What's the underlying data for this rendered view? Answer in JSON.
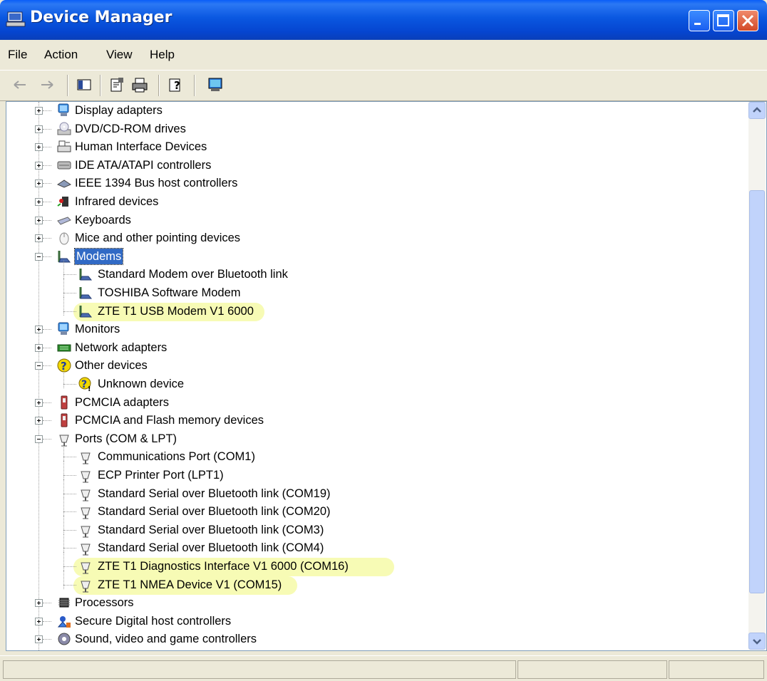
{
  "window": {
    "title": "Device Manager"
  },
  "menu": [
    "File",
    "Action",
    "View",
    "Help"
  ],
  "toolbar": {
    "icons": [
      "back-arrow-icon",
      "forward-arrow-icon",
      "show-hide-console-tree-icon",
      "properties-icon",
      "print-icon",
      "help-icon",
      "scan-hardware-icon"
    ]
  },
  "tree": [
    {
      "label": "Display adapters",
      "level": 0,
      "expander": "plus",
      "icon": "monitor-icon"
    },
    {
      "label": "DVD/CD-ROM drives",
      "level": 0,
      "expander": "plus",
      "icon": "cd-drive-icon"
    },
    {
      "label": "Human Interface Devices",
      "level": 0,
      "expander": "plus",
      "icon": "hid-icon"
    },
    {
      "label": "IDE ATA/ATAPI controllers",
      "level": 0,
      "expander": "plus",
      "icon": "ide-controller-icon"
    },
    {
      "label": "IEEE 1394 Bus host controllers",
      "level": 0,
      "expander": "plus",
      "icon": "firewire-icon"
    },
    {
      "label": "Infrared devices",
      "level": 0,
      "expander": "plus",
      "icon": "infrared-icon"
    },
    {
      "label": "Keyboards",
      "level": 0,
      "expander": "plus",
      "icon": "keyboard-icon"
    },
    {
      "label": "Mice and other pointing devices",
      "level": 0,
      "expander": "plus",
      "icon": "mouse-icon"
    },
    {
      "label": "Modems",
      "level": 0,
      "expander": "minus",
      "icon": "modem-icon",
      "selected": true
    },
    {
      "label": "Standard Modem over Bluetooth link",
      "level": 1,
      "icon": "modem-icon"
    },
    {
      "label": "TOSHIBA Software Modem",
      "level": 1,
      "icon": "modem-icon"
    },
    {
      "label": "ZTE T1 USB Modem V1 6000",
      "level": 1,
      "icon": "modem-icon",
      "highlight": true
    },
    {
      "label": "Monitors",
      "level": 0,
      "expander": "plus",
      "icon": "monitor-icon"
    },
    {
      "label": "Network adapters",
      "level": 0,
      "expander": "plus",
      "icon": "network-adapter-icon"
    },
    {
      "label": "Other devices",
      "level": 0,
      "expander": "minus",
      "icon": "unknown-device-icon"
    },
    {
      "label": "Unknown device",
      "level": 1,
      "icon": "unknown-device-warning-icon"
    },
    {
      "label": "PCMCIA adapters",
      "level": 0,
      "expander": "plus",
      "icon": "pcmcia-icon"
    },
    {
      "label": "PCMCIA and Flash memory devices",
      "level": 0,
      "expander": "plus",
      "icon": "pcmcia-icon"
    },
    {
      "label": "Ports (COM & LPT)",
      "level": 0,
      "expander": "minus",
      "icon": "port-icon"
    },
    {
      "label": "Communications Port (COM1)",
      "level": 1,
      "icon": "port-icon"
    },
    {
      "label": "ECP Printer Port (LPT1)",
      "level": 1,
      "icon": "port-icon"
    },
    {
      "label": "Standard Serial over Bluetooth link (COM19)",
      "level": 1,
      "icon": "port-icon"
    },
    {
      "label": "Standard Serial over Bluetooth link (COM20)",
      "level": 1,
      "icon": "port-icon"
    },
    {
      "label": "Standard Serial over Bluetooth link (COM3)",
      "level": 1,
      "icon": "port-icon"
    },
    {
      "label": "Standard Serial over Bluetooth link (COM4)",
      "level": 1,
      "icon": "port-icon"
    },
    {
      "label": "ZTE T1 Diagnostics Interface V1 6000 (COM16)",
      "level": 1,
      "icon": "port-icon",
      "highlight": true
    },
    {
      "label": "ZTE T1 NMEA Device V1 (COM15)",
      "level": 1,
      "icon": "port-icon",
      "highlight": true
    },
    {
      "label": "Processors",
      "level": 0,
      "expander": "plus",
      "icon": "processor-icon"
    },
    {
      "label": "Secure Digital host controllers",
      "level": 0,
      "expander": "plus",
      "icon": "sd-controller-icon"
    },
    {
      "label": "Sound, video and game controllers",
      "level": 0,
      "expander": "plus",
      "icon": "sound-icon"
    }
  ],
  "colors": {
    "title_bar": "#0a57e0",
    "selection": "#316ac5",
    "highlight": "#f0f878"
  }
}
